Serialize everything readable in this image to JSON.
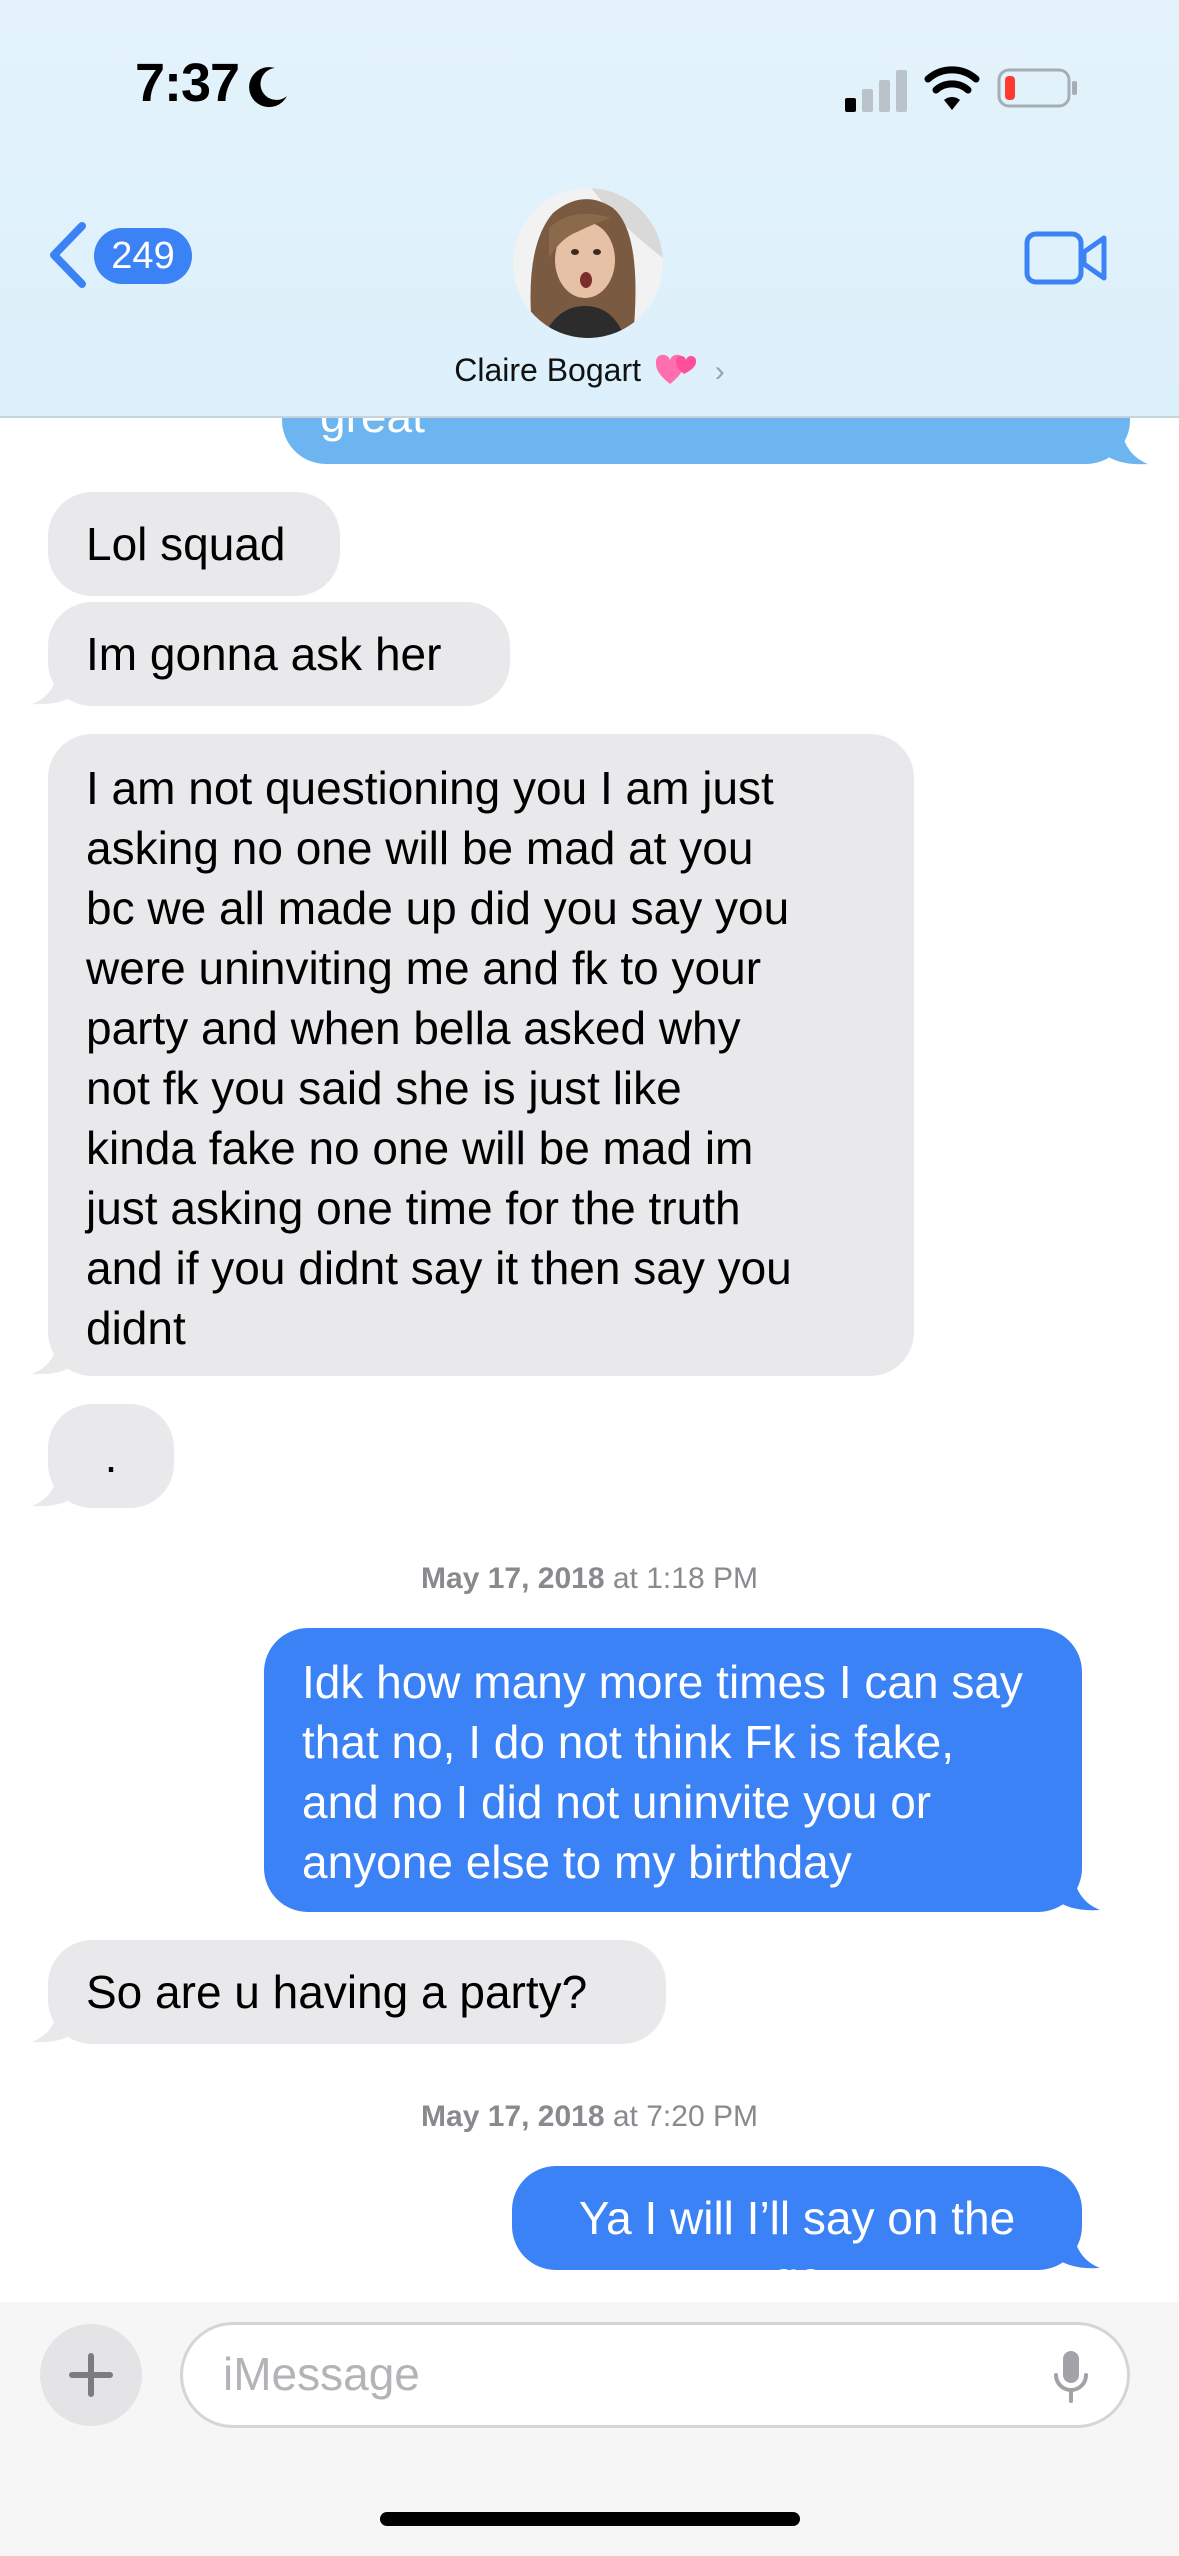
{
  "status_bar": {
    "time": "7:37"
  },
  "header": {
    "unread_count": "249",
    "contact_name": "Claire Bogart",
    "chevron": "›"
  },
  "messages": [
    {
      "from": "me",
      "text": "great"
    },
    {
      "from": "them",
      "text": "Lol squad"
    },
    {
      "from": "them",
      "text": "Im gonna ask her"
    },
    {
      "from": "them",
      "lines": [
        "I am not questioning you I am just",
        "asking no one will be mad at you",
        "bc we all made up did you say you",
        "were uninviting me and fk to your",
        "party and when bella asked why",
        "not fk you said she is just like",
        "kinda fake no one will be mad im",
        "just asking one time for the truth",
        "and if you didnt say it then say you",
        "didnt"
      ]
    },
    {
      "from": "them",
      "text": "."
    },
    {
      "from": "me",
      "lines": [
        "Idk how many more times I can say",
        "that no, I do not think Fk is fake,",
        "and no I did not uninvite you or",
        "anyone else to my birthday"
      ]
    },
    {
      "from": "them",
      "text": "So are u having a party?"
    },
    {
      "from": "me",
      "text": "Ya I will I’ll say on the gc"
    }
  ],
  "timestamps": [
    {
      "date": "May 17, 2018",
      "at": "at",
      "time": "1:18 PM"
    },
    {
      "date": "May 17, 2018",
      "at": "at",
      "time": "7:20 PM"
    }
  ],
  "composer": {
    "placeholder": "iMessage"
  },
  "colors": {
    "outgoing": "#3b82f6",
    "incoming": "#e9e9eb",
    "accent": "#3b82f6"
  },
  "icons": [
    "moon-icon",
    "signal-icon",
    "wifi-icon",
    "battery-icon",
    "back-chevron-icon",
    "facetime-video-icon",
    "heart-emoji-icon",
    "plus-icon",
    "microphone-icon"
  ]
}
